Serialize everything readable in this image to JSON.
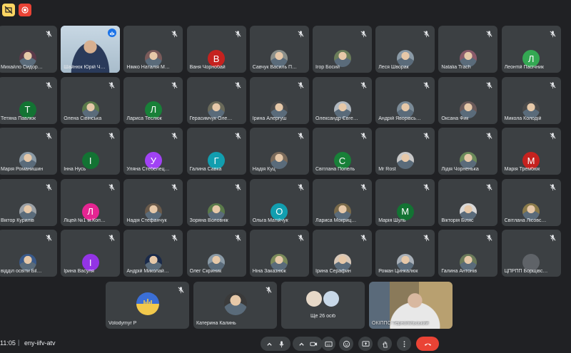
{
  "meeting": {
    "time": "11:05",
    "separator": "|",
    "code": "eny-iifv-atv"
  },
  "participants": [
    {
      "name": "Михайло Сидор…",
      "avatar_letter": "",
      "avatar_color": "#5b3a4a",
      "photo": true
    },
    {
      "name": "Шайнюк Юрій Ч…",
      "avatar_letter": "",
      "avatar_color": "#9fb6c6",
      "photo": true,
      "video": true,
      "speaking": true
    },
    {
      "name": "Німко Наталія М…",
      "avatar_letter": "",
      "avatar_color": "#7a5a5a",
      "photo": true
    },
    {
      "name": "Ваня Чорнобай",
      "avatar_letter": "В",
      "avatar_color": "#c5221f",
      "photo": false
    },
    {
      "name": "Савчук Василь П…",
      "avatar_letter": "",
      "avatar_color": "#8a8f8a",
      "photo": true
    },
    {
      "name": "Ігор Босий",
      "avatar_letter": "",
      "avatar_color": "#6a7d5a",
      "photo": true
    },
    {
      "name": "Леся Шворак",
      "avatar_letter": "",
      "avatar_color": "#8a9aa6",
      "photo": true
    },
    {
      "name": "Natalia Trach",
      "avatar_letter": "",
      "avatar_color": "#8a5a6a",
      "photo": true
    },
    {
      "name": "Леонтій Пасічник",
      "avatar_letter": "Л",
      "avatar_color": "#34a853",
      "photo": false
    },
    {
      "name": "Тетяна Павлюк",
      "avatar_letter": "Т",
      "avatar_color": "#137333",
      "photo": false
    },
    {
      "name": "Олена Сівінська",
      "avatar_letter": "",
      "avatar_color": "#5a7a4a",
      "photo": true
    },
    {
      "name": "Лариса Теслюк",
      "avatar_letter": "Л",
      "avatar_color": "#188038",
      "photo": false
    },
    {
      "name": "Герасимчук Оле…",
      "avatar_letter": "",
      "avatar_color": "#6a6a5a",
      "photo": true
    },
    {
      "name": "Ірина Алергуш",
      "avatar_letter": "",
      "avatar_color": "#4a4a4a",
      "photo": true
    },
    {
      "name": "Олександр Євге…",
      "avatar_letter": "",
      "avatar_color": "#b0b8c0",
      "photo": true
    },
    {
      "name": "Андрій Яворівсь…",
      "avatar_letter": "",
      "avatar_color": "#7a8a96",
      "photo": true
    },
    {
      "name": "Оксана Фик",
      "avatar_letter": "",
      "avatar_color": "#6a5a5a",
      "photo": true
    },
    {
      "name": "Микола Колодій",
      "avatar_letter": "",
      "avatar_color": "#4a4a4a",
      "photo": true
    },
    {
      "name": "Марія Романишин",
      "avatar_letter": "",
      "avatar_color": "#8a9aa6",
      "photo": true
    },
    {
      "name": "Інна Нусь",
      "avatar_letter": "І",
      "avatar_color": "#137333",
      "photo": false
    },
    {
      "name": "Уляна Стебелец…",
      "avatar_letter": "У",
      "avatar_color": "#a142f4",
      "photo": false
    },
    {
      "name": "Галина Савка",
      "avatar_letter": "Г",
      "avatar_color": "#129eaf",
      "photo": false
    },
    {
      "name": "Надія Куц",
      "avatar_letter": "",
      "avatar_color": "#7a6a5a",
      "photo": true
    },
    {
      "name": "Світлана Попель",
      "avatar_letter": "С",
      "avatar_color": "#188038",
      "photo": false
    },
    {
      "name": "Mr Rost",
      "avatar_letter": "",
      "avatar_color": "#c8c8c8",
      "photo": true
    },
    {
      "name": "Лідія Чорненька",
      "avatar_letter": "",
      "avatar_color": "#6a8a5a",
      "photo": true
    },
    {
      "name": "Марія Трембюк",
      "avatar_letter": "М",
      "avatar_color": "#c5221f",
      "photo": false
    },
    {
      "name": "Віктор Курилів",
      "avatar_letter": "",
      "avatar_color": "#9aa0a6",
      "photo": true
    },
    {
      "name": "Ліцей №1 м.Коп…",
      "avatar_letter": "Л",
      "avatar_color": "#e52592",
      "photo": false
    },
    {
      "name": "Надія Стефанчук",
      "avatar_letter": "",
      "avatar_color": "#6a5a4a",
      "photo": true
    },
    {
      "name": "Зоряна Воловнік",
      "avatar_letter": "",
      "avatar_color": "#5a7a4a",
      "photo": true
    },
    {
      "name": "Ольга Матійчук",
      "avatar_letter": "О",
      "avatar_color": "#129eaf",
      "photo": false
    },
    {
      "name": "Лариса Мокриц…",
      "avatar_letter": "",
      "avatar_color": "#7a6a4a",
      "photo": true
    },
    {
      "name": "Марія Шуль",
      "avatar_letter": "М",
      "avatar_color": "#137333",
      "photo": false
    },
    {
      "name": "Вікторія Біляс",
      "avatar_letter": "",
      "avatar_color": "#d8d8d8",
      "photo": true
    },
    {
      "name": "Світлана Лісовс…",
      "avatar_letter": "",
      "avatar_color": "#8a7a4a",
      "photo": true
    },
    {
      "name": "відділ освіти Бil…",
      "avatar_letter": "",
      "avatar_color": "#3a5a8a",
      "photo": true
    },
    {
      "name": "Ірина Васуля",
      "avatar_letter": "І",
      "avatar_color": "#9334e6",
      "photo": false
    },
    {
      "name": "Андрій Миколай…",
      "avatar_letter": "",
      "avatar_color": "#1a2a4a",
      "photo": true
    },
    {
      "name": "Олег Скриник",
      "avatar_letter": "",
      "avatar_color": "#8a9aa6",
      "photo": true
    },
    {
      "name": "Ніна Заказнюк",
      "avatar_letter": "",
      "avatar_color": "#7a8a5a",
      "photo": true
    },
    {
      "name": "Ірина Серафин",
      "avatar_letter": "",
      "avatar_color": "#d8c8b8",
      "photo": true
    },
    {
      "name": "Роман Цинкалюк",
      "avatar_letter": "",
      "avatar_color": "#a8b0b8",
      "photo": true
    },
    {
      "name": "Галина Антонів",
      "avatar_letter": "",
      "avatar_color": "#6a7a5a",
      "photo": true
    },
    {
      "name": "ЦПРПП Борщівс…",
      "avatar_letter": "",
      "avatar_color": "#5f6368",
      "photo": false
    }
  ],
  "bottom_row": [
    {
      "name": "Volodymyr P",
      "kind": "trident"
    },
    {
      "name": "Катерина Калинь",
      "kind": "photo"
    },
    {
      "name": "Ще 26 осіб",
      "kind": "more"
    },
    {
      "name": "ОКІППО Тернопільський",
      "kind": "video"
    }
  ],
  "controls": [
    "chevron-up-icon",
    "microphone-icon",
    "chevron-up-icon",
    "camera-icon",
    "captions-icon",
    "emoji-icon",
    "present-icon",
    "raise-hand-icon",
    "more-vert-icon",
    "end-call-icon"
  ],
  "colors": {
    "background": "#202124",
    "tile": "#3c4043",
    "speaking_outline": "#8ab4f8",
    "end_call": "#ea4335",
    "record": "#ea4335"
  }
}
